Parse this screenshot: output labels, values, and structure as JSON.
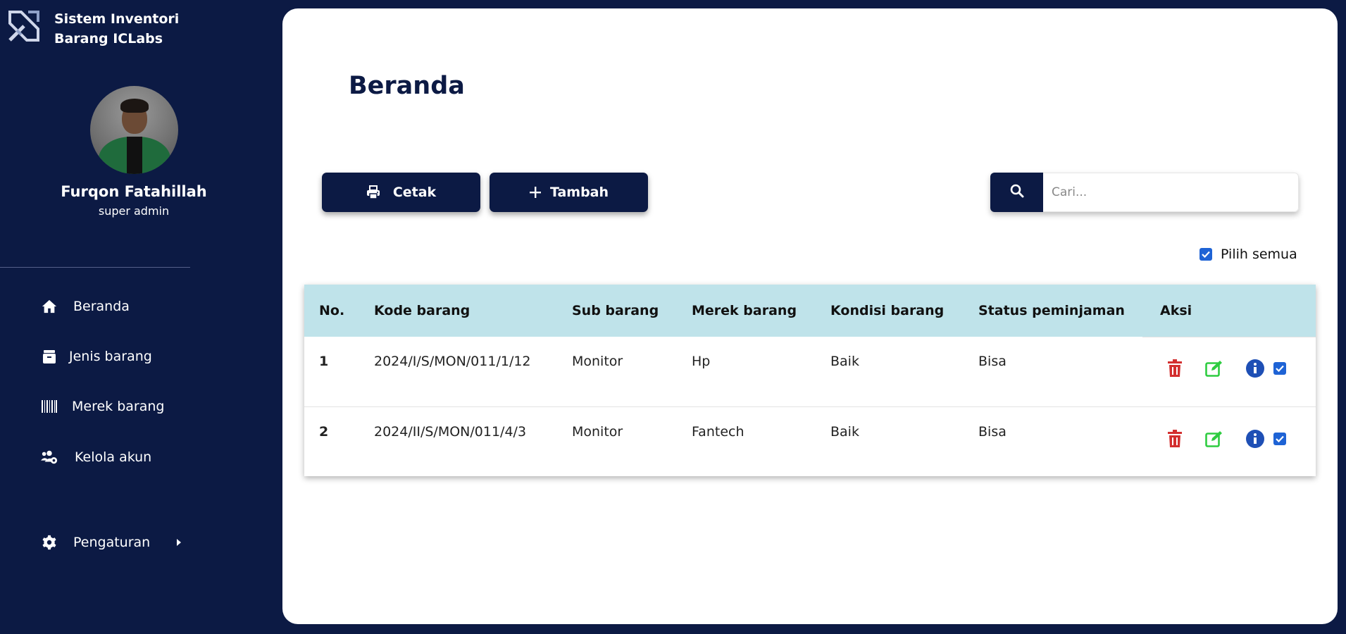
{
  "app": {
    "title": "Sistem Inventori Barang ICLabs"
  },
  "profile": {
    "name": "Furqon Fatahillah",
    "role": "super admin"
  },
  "nav": {
    "items": [
      {
        "label": "Beranda",
        "icon": "home-icon"
      },
      {
        "label": "Jenis barang",
        "icon": "box-icon"
      },
      {
        "label": "Merek barang",
        "icon": "barcode-icon"
      },
      {
        "label": "Kelola akun",
        "icon": "users-gear-icon"
      },
      {
        "label": "Pengaturan",
        "icon": "gear-icon"
      }
    ]
  },
  "page": {
    "title": "Beranda"
  },
  "toolbar": {
    "print_label": "Cetak",
    "add_label": "Tambah"
  },
  "search": {
    "placeholder": "Cari..."
  },
  "select_all": {
    "label": "Pilih semua",
    "checked": true
  },
  "table": {
    "headers": [
      "No.",
      "Kode barang",
      "Sub barang",
      "Merek barang",
      "Kondisi barang",
      "Status peminjaman",
      "Aksi"
    ],
    "rows": [
      {
        "no": "1",
        "kode": "2024/I/S/MON/011/1/12",
        "sub": "Monitor",
        "merek": "Hp",
        "kondisi": "Baik",
        "status": "Bisa",
        "checked": true
      },
      {
        "no": "2",
        "kode": "2024/II/S/MON/011/4/3",
        "sub": "Monitor",
        "merek": "Fantech",
        "kondisi": "Baik",
        "status": "Bisa",
        "checked": true
      }
    ]
  },
  "colors": {
    "navy": "#0c1a44",
    "header_bg": "#bfe3ea",
    "delete": "#d32f2f",
    "edit": "#2ecc40",
    "info": "#1e4fb5",
    "checkbox": "#1e63d5"
  }
}
